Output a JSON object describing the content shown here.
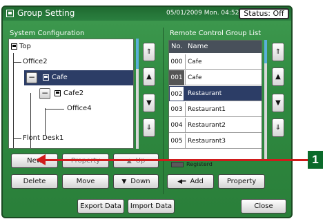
{
  "title_bar": {
    "title": "Group Setting",
    "datetime": "05/01/2009 Mon. 04:52 PM",
    "status": "Status: Off"
  },
  "system_configuration": {
    "label": "System Configuration",
    "tree": [
      {
        "label": "Top",
        "selected": false
      },
      {
        "label": "Office2",
        "selected": false
      },
      {
        "label": "Cafe",
        "selected": true
      },
      {
        "label": "Cafe2",
        "selected": false
      },
      {
        "label": "Office4",
        "selected": false
      },
      {
        "label": "Flont Desk1",
        "selected": false
      }
    ],
    "buttons": {
      "new": "New",
      "property": "Property",
      "up": "Up",
      "delete": "Delete",
      "move": "Move",
      "down": "Down"
    }
  },
  "remote_group_list": {
    "label": "Remote Control Group List",
    "headers": {
      "no": "No.",
      "name": "Name"
    },
    "rows": [
      {
        "no": "000",
        "name": "Cafe",
        "selected": false,
        "dark_no": false
      },
      {
        "no": "001",
        "name": "Cafe",
        "selected": false,
        "dark_no": true
      },
      {
        "no": "002",
        "name": "Restaurant",
        "selected": true,
        "dark_no": false
      },
      {
        "no": "003",
        "name": "Restaurant1",
        "selected": false,
        "dark_no": false
      },
      {
        "no": "004",
        "name": "Restaurant2",
        "selected": false,
        "dark_no": false
      },
      {
        "no": "005",
        "name": "Restaurant3",
        "selected": false,
        "dark_no": false
      }
    ],
    "legend": "Registerd",
    "buttons": {
      "add": "Add",
      "property": "Property"
    }
  },
  "footer": {
    "export": "Export Data",
    "import": "Import Data",
    "close": "Close"
  },
  "callout": {
    "number": "1"
  },
  "colors": {
    "panel_green": "#2f8a40",
    "selection": "#2c3d66",
    "callout_red": "#d01b1b"
  }
}
